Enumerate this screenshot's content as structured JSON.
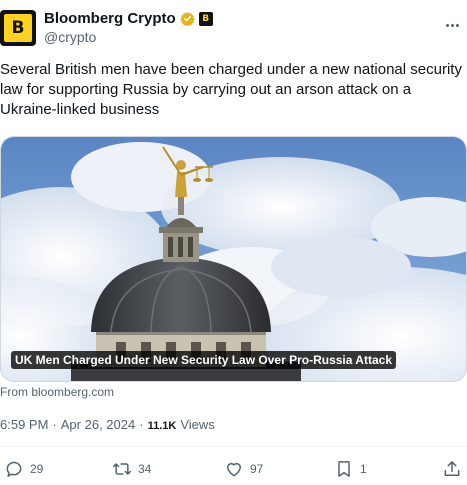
{
  "author": {
    "avatar_letter": "B",
    "display_name": "Bloomberg Crypto",
    "handle": "@crypto",
    "avatar_bg": "#111111",
    "avatar_fg": "#ffd21f",
    "verified_color": "#e2b719"
  },
  "tweet": {
    "text": "Several British men have been charged under a new national security law for supporting Russia by carrying out an arson attack on a Ukraine-linked business"
  },
  "media": {
    "caption": "UK Men Charged Under New Security Law Over Pro-Russia Attack",
    "source": "From bloomberg.com"
  },
  "meta": {
    "time": "6:59 PM",
    "separator1": "·",
    "date": "Apr 26, 2024",
    "separator2": "·",
    "views_count": "11.1K",
    "views_label": "Views"
  },
  "actions": {
    "replies": "29",
    "reposts": "34",
    "likes": "97",
    "bookmarks": "1"
  },
  "icons": [
    "verified-badge-icon",
    "affiliate-badge-icon",
    "more-icon",
    "reply-icon",
    "repost-icon",
    "like-icon",
    "bookmark-icon",
    "share-icon"
  ]
}
